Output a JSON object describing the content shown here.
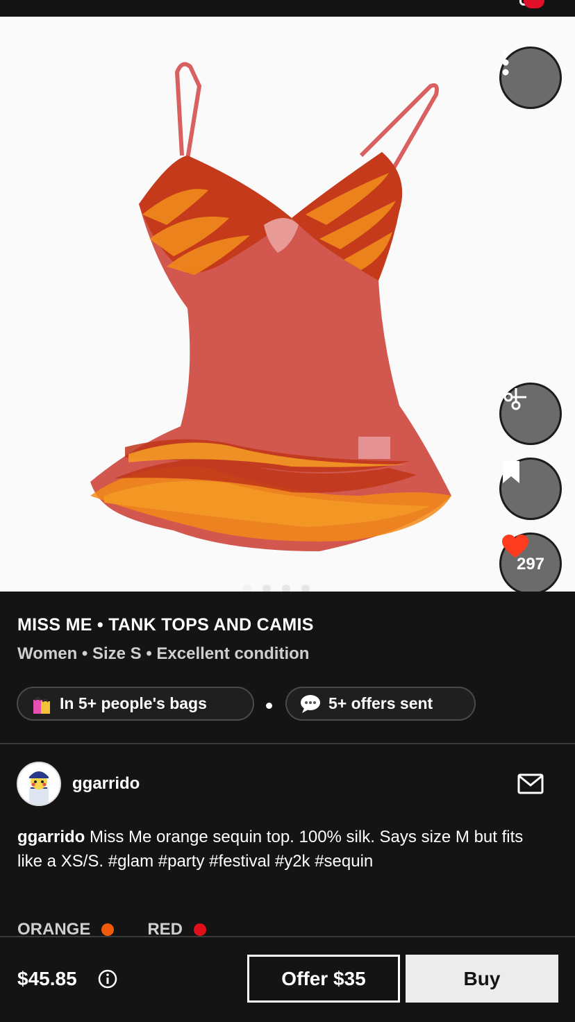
{
  "listing": {
    "brand_category": "MISS ME • TANK TOPS AND CAMIS",
    "meta": "Women • Size S • Excellent condition",
    "likes": "297",
    "photo_count": 4,
    "active_photo": 1
  },
  "badges": {
    "bags": "In 5+ people's bags",
    "offers": "5+ offers sent"
  },
  "seller": {
    "username": "ggarrido"
  },
  "description": {
    "author": "ggarrido",
    "text": " Miss Me orange sequin top. 100% silk. Says size M but fits like a XS/S. #glam #party #festival #y2k #sequin"
  },
  "colors": [
    {
      "label": "ORANGE",
      "hex": "#f05a0a"
    },
    {
      "label": "RED",
      "hex": "#e0101a"
    }
  ],
  "purchase": {
    "price": "$45.85",
    "offer_label": "Offer $35",
    "buy_label": "Buy"
  },
  "icons": {
    "more": "more-vertical-icon",
    "style": "style-match-icon",
    "save": "bookmark-icon",
    "like": "heart-icon",
    "mail": "mail-icon",
    "info": "info-icon",
    "bag": "shopping-bag-icon",
    "speech": "speech-bubble-icon"
  },
  "theme": {
    "background": "#141414",
    "accent_red": "#ff3b1f",
    "button_light": "#ececec"
  }
}
